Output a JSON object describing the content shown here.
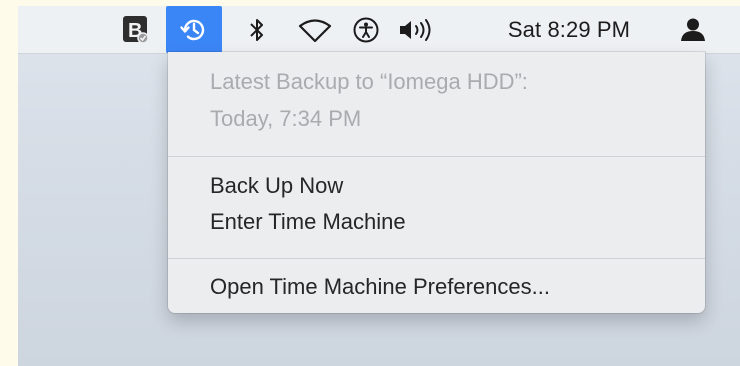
{
  "menubar": {
    "icons": [
      "bbedit-icon",
      "time-machine-icon",
      "bluetooth-icon",
      "wifi-icon",
      "accessibility-icon",
      "volume-icon",
      "user-icon"
    ],
    "clock": "Sat 8:29 PM",
    "active_color": "#3b86f7"
  },
  "menu": {
    "status_line1": "Latest Backup to “Iomega HDD”:",
    "status_line2": "Today, 7:34 PM",
    "back_up_now": "Back Up Now",
    "enter_time_machine": "Enter Time Machine",
    "open_preferences": "Open Time Machine Preferences..."
  }
}
